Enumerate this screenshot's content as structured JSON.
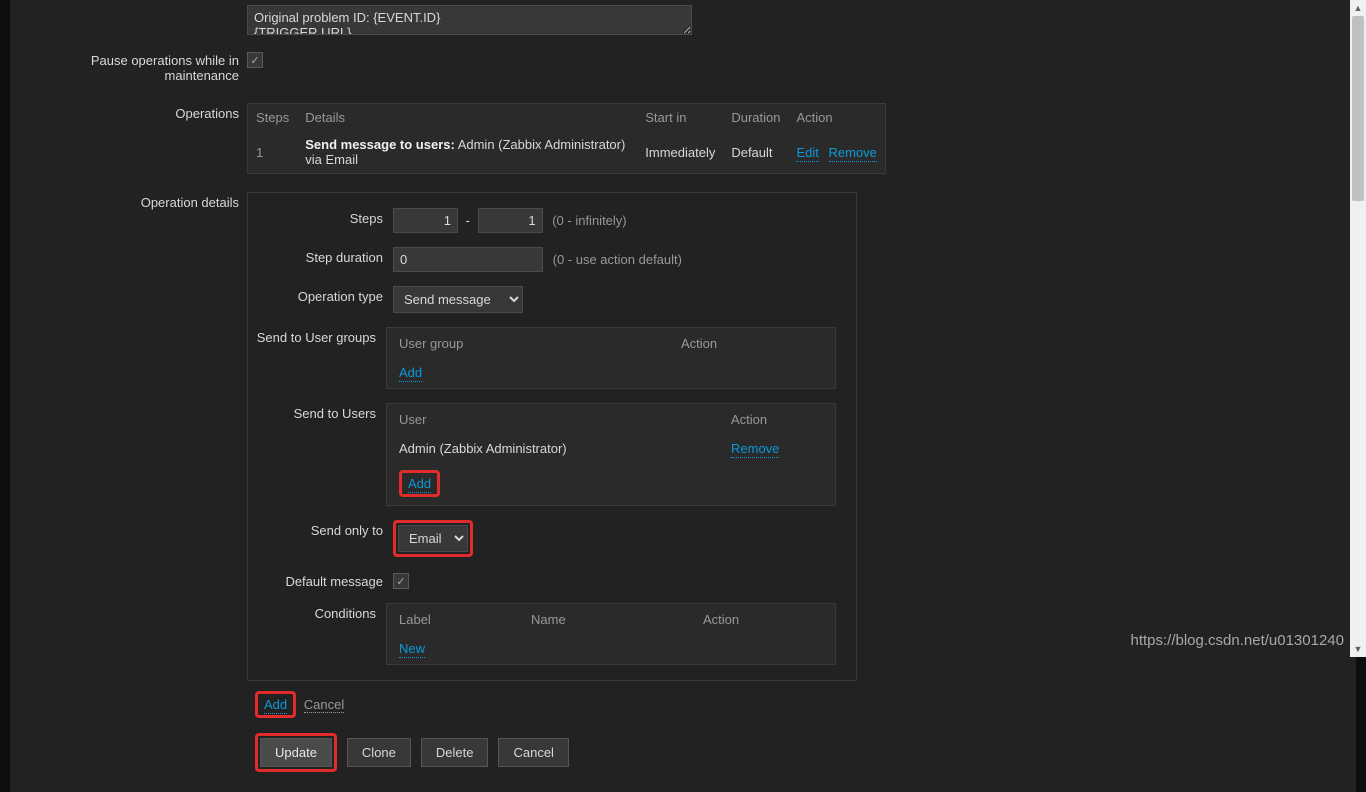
{
  "textarea_content": "Original problem ID: {EVENT.ID}\n{TRIGGER.URL}",
  "labels": {
    "pause_operations": "Pause operations while in maintenance",
    "operations": "Operations",
    "operation_details": "Operation details"
  },
  "operations_table": {
    "headers": {
      "steps": "Steps",
      "details": "Details",
      "start_in": "Start in",
      "duration": "Duration",
      "action": "Action"
    },
    "row": {
      "step": "1",
      "details_prefix": "Send message to users:",
      "details_text": " Admin (Zabbix Administrator) via Email",
      "start_in": "Immediately",
      "duration": "Default",
      "edit": "Edit",
      "remove": "Remove"
    }
  },
  "details": {
    "steps_label": "Steps",
    "steps_from": "1",
    "steps_to": "1",
    "steps_hint": "(0 - infinitely)",
    "step_duration_label": "Step duration",
    "step_duration_value": "0",
    "step_duration_hint": "(0 - use action default)",
    "operation_type_label": "Operation type",
    "operation_type_value": "Send message",
    "send_user_groups_label": "Send to User groups",
    "user_group_header": "User group",
    "action_header": "Action",
    "add_link": "Add",
    "send_users_label": "Send to Users",
    "user_header": "User",
    "user_value": "Admin (Zabbix Administrator)",
    "remove_link": "Remove",
    "send_only_to_label": "Send only to",
    "send_only_to_value": "Email",
    "default_message_label": "Default message",
    "conditions_label": "Conditions",
    "label_header": "Label",
    "name_header": "Name",
    "new_link": "New"
  },
  "add_cancel": {
    "add": "Add",
    "cancel": "Cancel"
  },
  "buttons": {
    "update": "Update",
    "clone": "Clone",
    "delete": "Delete",
    "cancel": "Cancel"
  },
  "watermark": "https://blog.csdn.net/u01301240",
  "colors": {
    "highlight": "#e22b2b",
    "link": "#0a9ad9",
    "background": "#222222"
  }
}
